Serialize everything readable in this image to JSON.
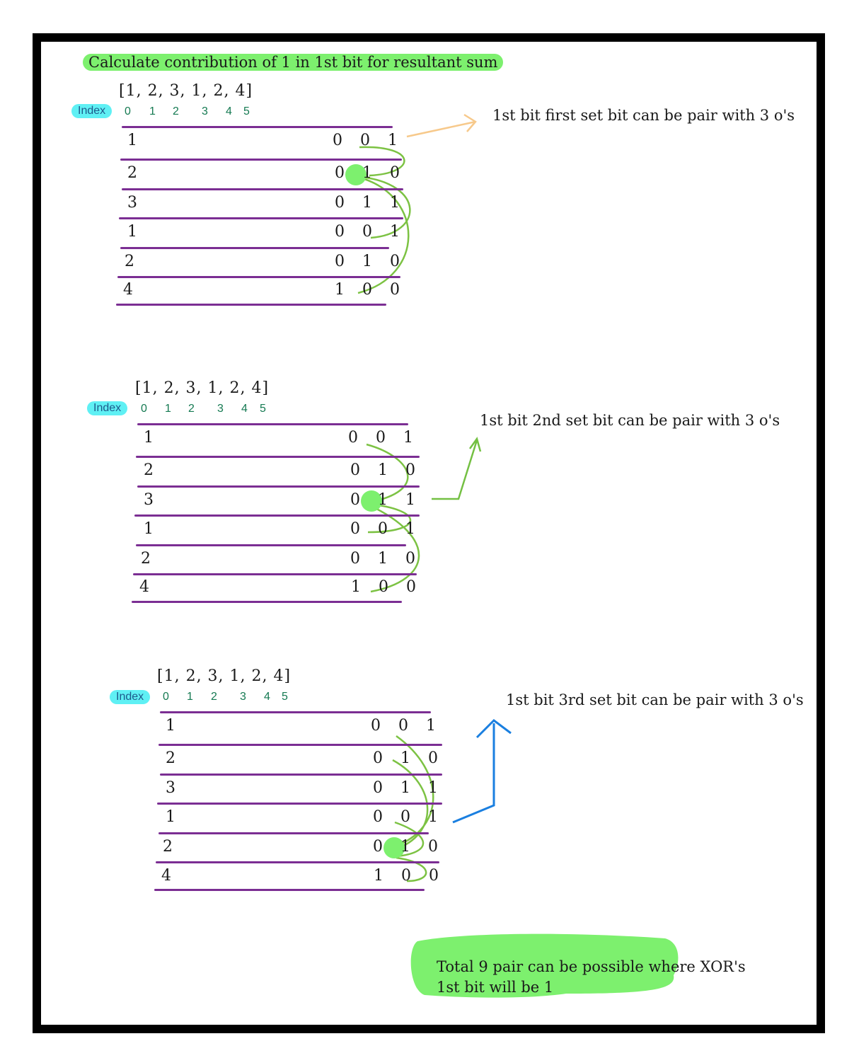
{
  "title": "Calculate contribution of 1 in 1st bit for resultant sum",
  "array_text": "[1,  2,  3,   1,  2,  4]",
  "index_label": "Index",
  "indices": [
    "0",
    "1",
    "2",
    "3",
    "4",
    "5"
  ],
  "rows": [
    {
      "num": "1",
      "bits": "0 0 1"
    },
    {
      "num": "2",
      "bits": "0 1 0"
    },
    {
      "num": "3",
      "bits": "0 1 1"
    },
    {
      "num": "1",
      "bits": "0 0 1"
    },
    {
      "num": "2",
      "bits": "0 1 0"
    },
    {
      "num": "4",
      "bits": "1 0 0"
    }
  ],
  "notes": [
    "1st bit first set bit can be pair with 3 o's",
    "1st bit 2nd set bit can be pair with 3 o's",
    "1st bit 3rd set bit can be pair with 3 o's"
  ],
  "total_line1": "Total 9 pair can be possible where XOR's",
  "total_line2": "1st bit will be 1",
  "colors": {
    "highlight": "#7df06e",
    "index_tag": "#5ff0f4",
    "row_line": "#7b2e93",
    "curve": "#7cc243",
    "arrow_orange": "#f7c98b",
    "arrow_green": "#74c043",
    "arrow_blue": "#1a7fe0"
  }
}
